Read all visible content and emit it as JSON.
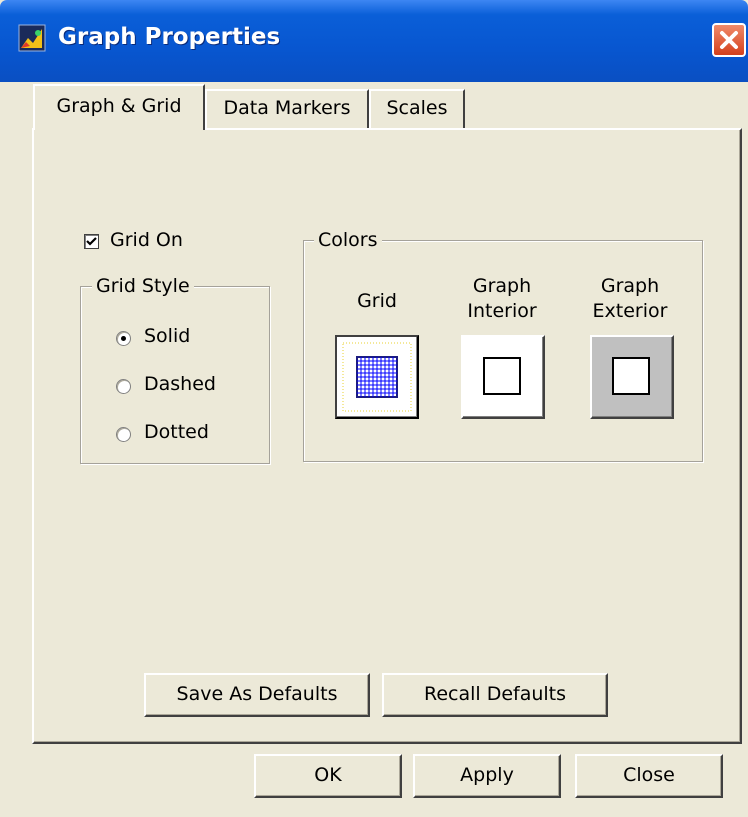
{
  "window": {
    "title": "Graph Properties",
    "icon": "graph-app-icon",
    "close_icon": "close-icon"
  },
  "tabs": [
    {
      "label": "Graph & Grid",
      "active": true
    },
    {
      "label": "Data Markers",
      "active": false
    },
    {
      "label": "Scales",
      "active": false
    }
  ],
  "grid": {
    "grid_on_label": "Grid On",
    "grid_on_checked": true,
    "style_group_label": "Grid Style",
    "styles": [
      {
        "label": "Solid",
        "selected": true
      },
      {
        "label": "Dashed",
        "selected": false
      },
      {
        "label": "Dotted",
        "selected": false
      }
    ]
  },
  "colors": {
    "group_label": "Colors",
    "grid_label": "Grid",
    "graph_interior_label_line1": "Graph",
    "graph_interior_label_line2": "Interior",
    "graph_exterior_label_line1": "Graph",
    "graph_exterior_label_line2": "Exterior",
    "grid_color": "#0000ff",
    "interior_color": "#ffffff",
    "exterior_color": "#c0c0c0"
  },
  "defaults": {
    "save_label": "Save As Defaults",
    "recall_label": "Recall Defaults"
  },
  "footer": {
    "ok_label": "OK",
    "apply_label": "Apply",
    "close_label": "Close"
  }
}
